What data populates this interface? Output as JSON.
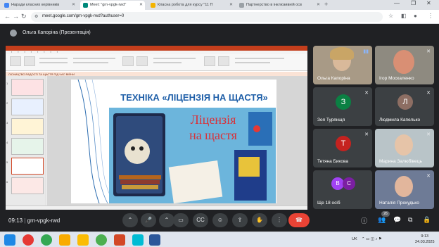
{
  "browser": {
    "tabs": [
      {
        "title": "Наради класних керівників"
      },
      {
        "title": "Meet: \"grn-vpgk-rwd\""
      },
      {
        "title": "Класна робота для курсу \"11 П"
      },
      {
        "title": "Партнерство в інклюзивній осв"
      }
    ],
    "url": "meet.google.com/grn-vpgk-rwd?authuser=0"
  },
  "meet": {
    "presenter_label": "Ольга Капоріна (Презентація)",
    "meeting_time": "09:13",
    "meeting_code": "grn-vpgk-rwd",
    "participant_count_badge": "26",
    "participants": [
      {
        "name": "Ольга Капоріна",
        "type": "video"
      },
      {
        "name": "Ігор Москаленко",
        "type": "video"
      },
      {
        "name": "Зоя Турянщя",
        "type": "avatar",
        "initial": "З",
        "color": "#0b8043"
      },
      {
        "name": "Людмила Капелько",
        "type": "avatar",
        "initial": "Л",
        "color": "#8d6e63"
      },
      {
        "name": "Тетяна Бикова",
        "type": "avatar",
        "initial": "Т",
        "color": "#c5221f"
      },
      {
        "name": "Марина Залюбівець",
        "type": "video"
      },
      {
        "name": "Ще 18 осіб",
        "type": "group",
        "initials": [
          "В",
          "С"
        ]
      },
      {
        "name": "Наталія Прокудько",
        "type": "video"
      }
    ]
  },
  "slide": {
    "doc_title": "ЛІСНИЦТВО РАДОСТІ ТА ЩАСТЯ ПІД ЧАС ВІЙНИ",
    "heading": "ТЕХНІКА «ЛІЦЕНЗІЯ НА ЩАСТЯ»",
    "book_title_line1": "Ліцензія",
    "book_title_line2": "на щастя"
  },
  "taskbar": {
    "lang": "UK",
    "time": "9:13",
    "date": "24.03.2025"
  }
}
